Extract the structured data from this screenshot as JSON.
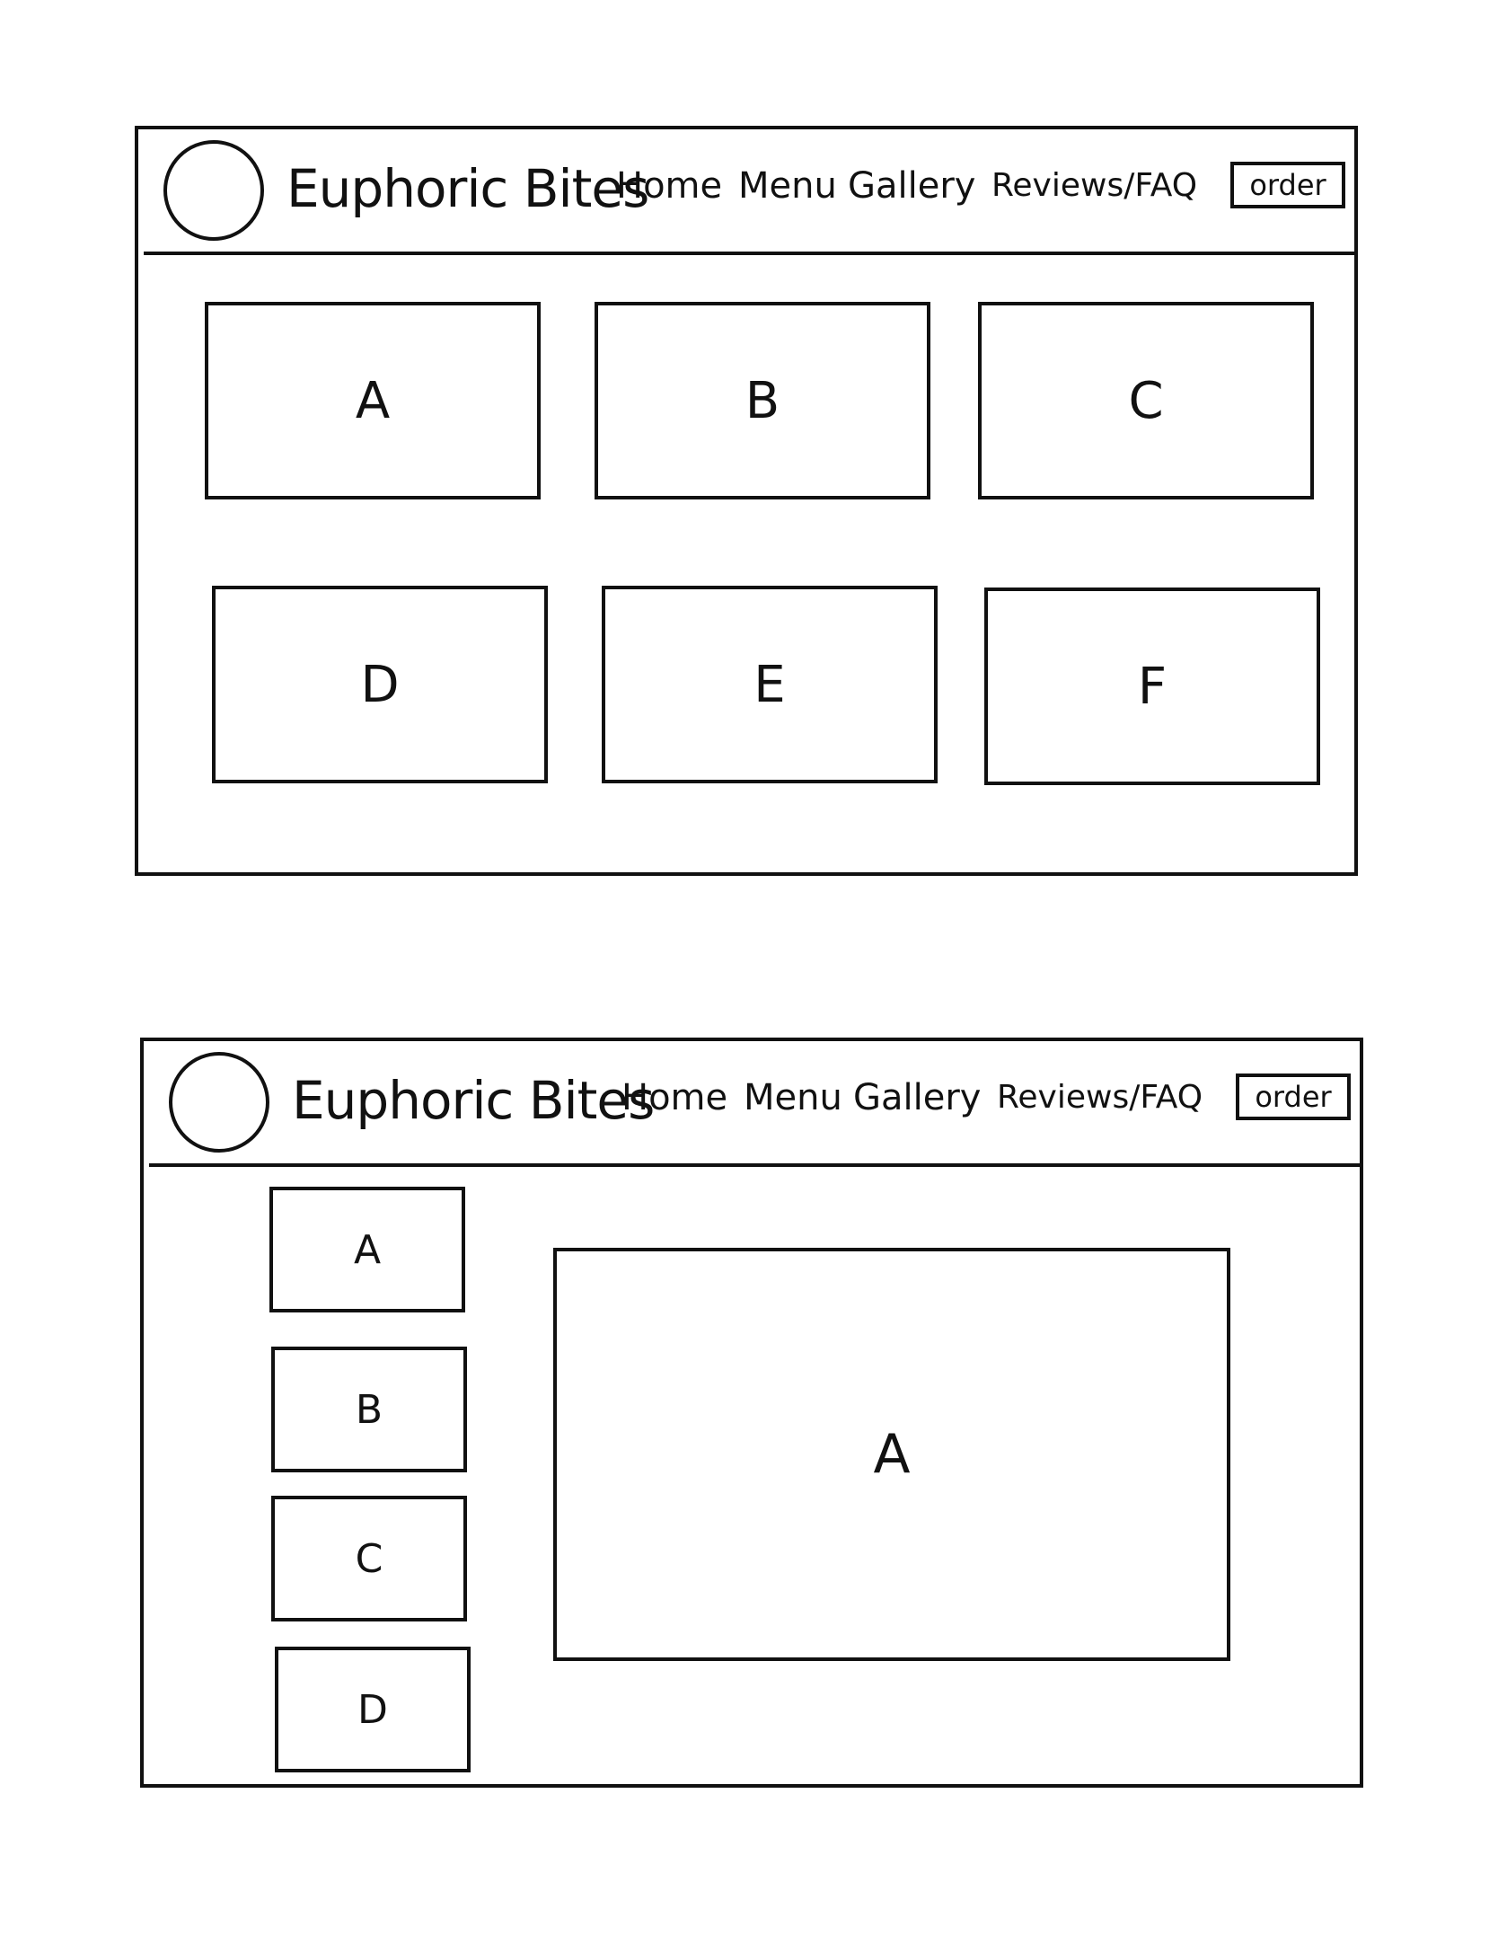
{
  "wireframe_1": {
    "brand": "Euphoric Bites",
    "nav": [
      "Home",
      "Menu",
      "Gallery",
      "Reviews/FAQ"
    ],
    "order_label": "order",
    "tiles": [
      "A",
      "B",
      "C",
      "D",
      "E",
      "F"
    ]
  },
  "wireframe_2": {
    "brand": "Euphoric Bites",
    "nav": [
      "Home",
      "Menu",
      "Gallery",
      "Reviews/FAQ"
    ],
    "order_label": "order",
    "thumbnails": [
      "A",
      "B",
      "C",
      "D"
    ],
    "main_view": "A"
  }
}
